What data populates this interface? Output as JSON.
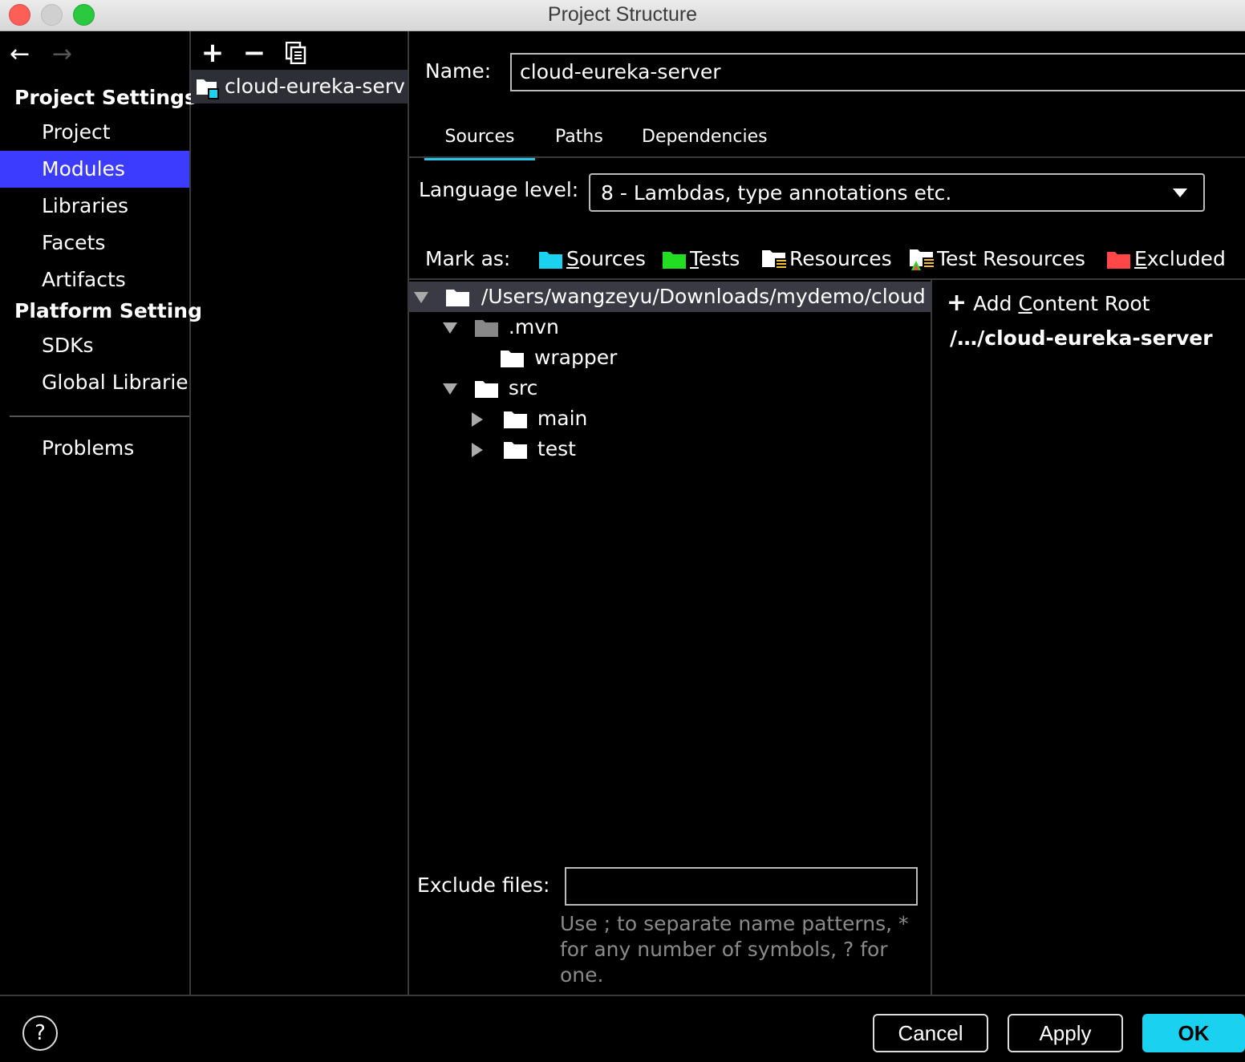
{
  "window": {
    "title": "Project Structure"
  },
  "nav": {
    "back": "←",
    "forward": "→",
    "project_settings": "Project Settings",
    "items_project": [
      "Project",
      "Modules",
      "Libraries",
      "Facets",
      "Artifacts"
    ],
    "platform_settings": "Platform Setting",
    "items_platform": [
      "SDKs",
      "Global Librarie"
    ],
    "problems": "Problems"
  },
  "modules": {
    "toolbar": {
      "add": "+",
      "remove": "−"
    },
    "list": [
      "cloud-eureka-serv"
    ]
  },
  "main": {
    "name_label": "Name:",
    "name_value": "cloud-eureka-server",
    "tabs": [
      "Sources",
      "Paths",
      "Dependencies"
    ],
    "active_tab": "Sources",
    "language_label": "Language level:",
    "language_value": "8 - Lambdas, type annotations etc.",
    "mark_label": "Mark as:",
    "mark_items": [
      {
        "first": "S",
        "rest": "ources",
        "color": "#1ad2f0"
      },
      {
        "first": "T",
        "rest": "ests",
        "color": "#22dd22"
      },
      {
        "first": "",
        "rest": "Resources",
        "color": "#ffffff"
      },
      {
        "first": "",
        "rest": "Test Resources",
        "color": "#ffffff"
      },
      {
        "first": "E",
        "rest": "xcluded",
        "color": "#ff4747"
      }
    ],
    "tree": {
      "root": "/Users/wangzeyu/Downloads/mydemo/cloud",
      "mvn": ".mvn",
      "wrapper": "wrapper",
      "src": "src",
      "main": "main",
      "test": "test"
    },
    "exclude_label": "Exclude files:",
    "exclude_value": "",
    "hint": "Use ; to separate name patterns, * for any number of symbols, ? for one."
  },
  "content_root": {
    "add_plus": "+",
    "add_pre": "Add ",
    "add_ul": "C",
    "add_post": "ontent Root",
    "path": "/…/cloud-eureka-server"
  },
  "footer": {
    "help": "?",
    "cancel": "Cancel",
    "apply": "Apply",
    "ok": "OK"
  },
  "colors": {
    "accent": "#2ac2e6",
    "selection": "#3c3cff",
    "ok_button": "#1ad2f0"
  }
}
